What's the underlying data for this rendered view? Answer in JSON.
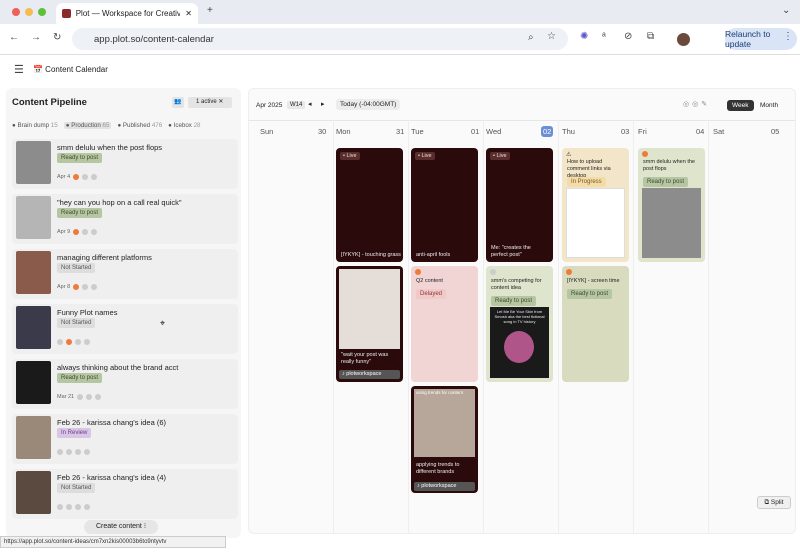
{
  "browser": {
    "tab_title": "Plot — Workspace for Creativ",
    "url": "app.plot.so/content-calendar",
    "relaunch": "Relaunch to update",
    "status_url": "https://app.plot.so/content-ideas/cm7xn2kis00003b6to9ntyvtv"
  },
  "app": {
    "title": "📅 Content Calendar"
  },
  "pipeline": {
    "title": "Content Pipeline",
    "filter": "1 active",
    "tabs": [
      {
        "label": "Brain dump",
        "count": "15"
      },
      {
        "label": "Production",
        "count": "65"
      },
      {
        "label": "Published",
        "count": "476"
      },
      {
        "label": "Icebox",
        "count": "28"
      }
    ],
    "items": [
      {
        "title": "smm delulu when the post flops",
        "status": "Ready to post",
        "date": "Apr 4"
      },
      {
        "title": "\"hey can you hop on a call real quick\"",
        "status": "Ready to post",
        "date": "Apr 9"
      },
      {
        "title": "managing different platforms",
        "status": "Not Started",
        "date": "Apr 8"
      },
      {
        "title": "Funny Plot names",
        "status": "Not Started",
        "date": ""
      },
      {
        "title": "always thinking about the brand acct",
        "status": "Ready to post",
        "date": "Mar 21"
      },
      {
        "title": "Feb 26 - karissa chang's idea (6)",
        "status": "In Review",
        "date": ""
      },
      {
        "title": "Feb 26 - karissa chang's idea (4)",
        "status": "Not Started",
        "date": ""
      }
    ],
    "create": "Create content"
  },
  "calendar": {
    "month": "Apr 2025",
    "week": "W14",
    "today": "Today (-04:00GMT)",
    "view_week": "Week",
    "view_month": "Month",
    "days": [
      {
        "name": "Sun",
        "num": "30"
      },
      {
        "name": "Mon",
        "num": "31"
      },
      {
        "name": "Tue",
        "num": "01"
      },
      {
        "name": "Wed",
        "num": "02"
      },
      {
        "name": "Thu",
        "num": "03"
      },
      {
        "name": "Fri",
        "num": "04"
      },
      {
        "name": "Sat",
        "num": "05"
      }
    ],
    "live": "Live",
    "cards": {
      "mon1": "[IYKYK] - touching grass",
      "tue1": "anti-april fools",
      "wed1": "Me: \"creates the perfect post\"",
      "thu1": "How to upload comment links via desktop",
      "thu1s": "In Progress",
      "fri1": "smm delulu when the post flops",
      "fri1s": "Ready to post",
      "mon2": "\"wait your post was really funny\"",
      "mon2h": "plotworkspace",
      "tue2": "Q2 content",
      "tue2s": "Delayed",
      "wed2": "smm's competing for content idea",
      "wed2s": "Ready to post",
      "wed2o": "Let Me Be Your Skin from Smosh aka the best fictional song in TV history",
      "thu2": "[IYKYK] - screen time",
      "thu2s": "Ready to post",
      "tue3": "applying trends to different brands",
      "tue3h": "plotworkspace",
      "tue3o": "using trends for content"
    },
    "split": "Split"
  }
}
